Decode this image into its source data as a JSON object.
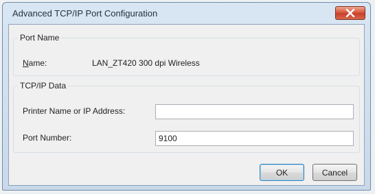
{
  "dialog": {
    "title": "Advanced TCP/IP Port Configuration",
    "close_icon": "close-icon"
  },
  "port_name_group": {
    "legend": "Port Name",
    "name_label_underlined": "N",
    "name_label_rest": "ame:",
    "name_value": "LAN_ZT420 300 dpi Wireless"
  },
  "tcpip_group": {
    "legend": "TCP/IP Data",
    "printer_label": "Printer Name or IP Address:",
    "printer_value": "",
    "port_label": "Port Number:",
    "port_value": "9100"
  },
  "buttons": {
    "ok": "OK",
    "cancel": "Cancel"
  },
  "colors": {
    "close_button": "#c8402a",
    "frame": "#c9d9ea"
  }
}
